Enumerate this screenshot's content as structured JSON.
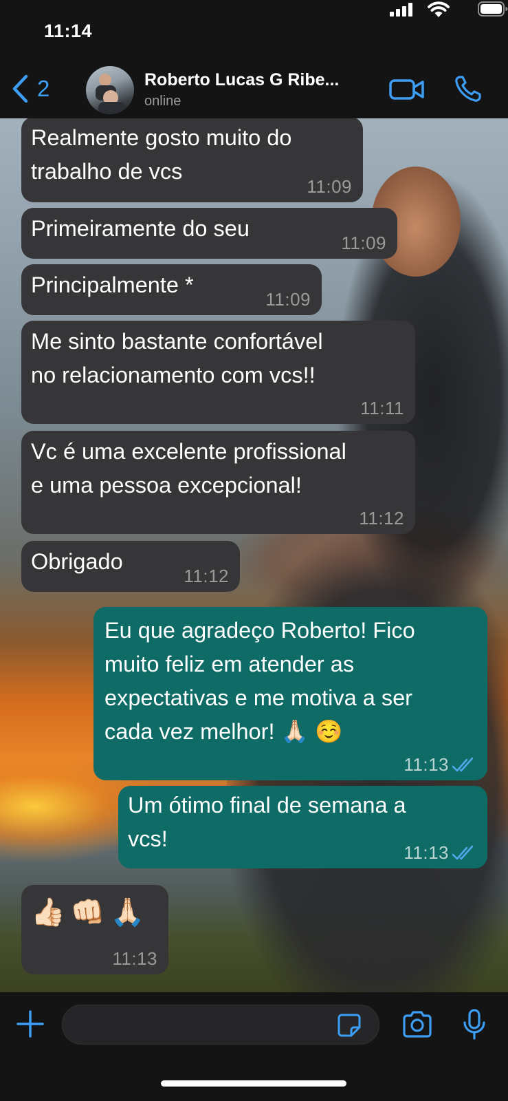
{
  "status_bar": {
    "time": "11:14"
  },
  "header": {
    "back_count": "2",
    "contact_name": "Roberto Lucas G Ribe...",
    "contact_status": "online"
  },
  "messages": [
    {
      "direction": "incoming",
      "lines": [
        "Realmente gosto muito do",
        "trabalho de vcs"
      ],
      "time": "11:09"
    },
    {
      "direction": "incoming",
      "lines": [
        "Primeiramente do seu"
      ],
      "time": "11:09"
    },
    {
      "direction": "incoming",
      "lines": [
        "Principalmente *"
      ],
      "time": "11:09"
    },
    {
      "direction": "incoming",
      "lines": [
        "Me sinto bastante confortável",
        "no relacionamento com vcs!!"
      ],
      "time": "11:11"
    },
    {
      "direction": "incoming",
      "lines": [
        "Vc é uma excelente profissional",
        "e uma pessoa excepcional!"
      ],
      "time": "11:12"
    },
    {
      "direction": "incoming",
      "lines": [
        "Obrigado"
      ],
      "time": "11:12"
    },
    {
      "direction": "outgoing",
      "lines": [
        "Eu que agradeço Roberto! Fico",
        "muito feliz em atender as",
        "expectativas e me motiva a ser",
        "cada vez melhor! 🙏🏻 ☺️"
      ],
      "time": "11:13",
      "read": true
    },
    {
      "direction": "outgoing",
      "lines": [
        "Um ótimo final de semana a",
        "vcs!"
      ],
      "time": "11:13",
      "read": true
    },
    {
      "direction": "incoming",
      "lines": [
        "👍🏻👊🏻🙏🏻"
      ],
      "time": "11:13"
    }
  ],
  "colors": {
    "accent": "#3d9ef5",
    "incoming_bubble": "#363638",
    "outgoing_bubble": "#0e6b66",
    "read_ticks": "#4fa8ea"
  },
  "icons": [
    "chevron-left-icon",
    "video-call-icon",
    "phone-icon",
    "plus-icon",
    "sticker-icon",
    "camera-icon",
    "microphone-icon",
    "double-check-icon"
  ]
}
